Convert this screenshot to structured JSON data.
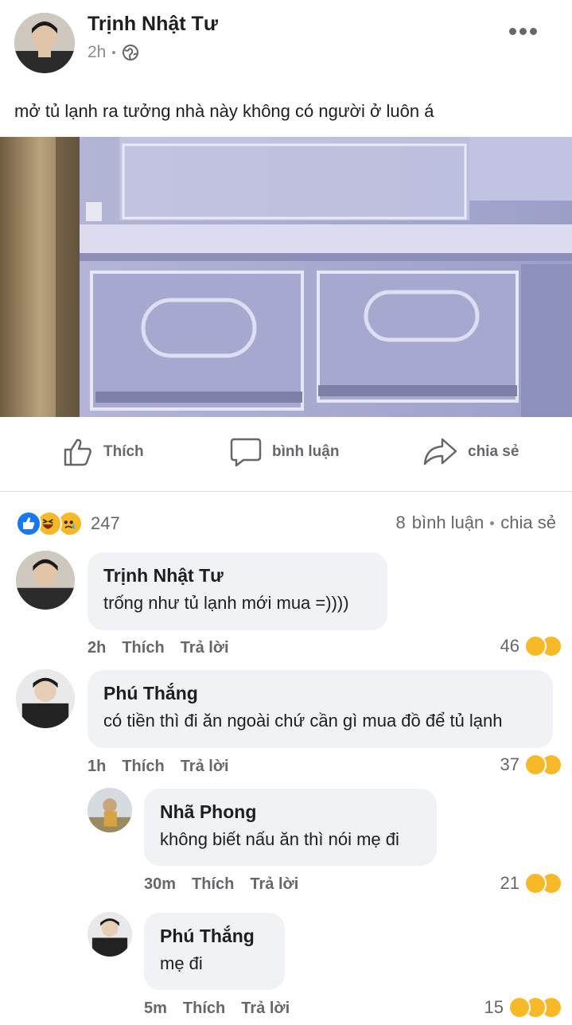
{
  "post": {
    "author": "Trịnh Nhật Tư",
    "time": "2h",
    "text": "mở tủ lạnh ra tưởng nhà này không có người ở luôn á"
  },
  "actions": {
    "like": "Thích",
    "comment": "bình luận",
    "share": "chia sẻ"
  },
  "summary": {
    "reaction_count": "247",
    "comment_count": "8",
    "comments_label": "bình luận",
    "share_label": "chia sẻ",
    "reactions": [
      "like",
      "haha",
      "sad"
    ]
  },
  "comments": [
    {
      "name": "Trịnh Nhật Tư",
      "text": "trống như tủ lạnh mới mua =))))",
      "time": "2h",
      "like": "Thích",
      "reply": "Trả lời",
      "count": "46"
    },
    {
      "name": "Phú Thắng",
      "text": "có tiền thì đi ăn ngoài chứ cần gì mua đồ để tủ lạnh",
      "time": "1h",
      "like": "Thích",
      "reply": "Trả lời",
      "count": "37"
    },
    {
      "name": "Nhã Phong",
      "text": "không biết nấu ăn thì nói mẹ đi",
      "time": "30m",
      "like": "Thích",
      "reply": "Trả lời",
      "count": "21"
    },
    {
      "name": "Phú Thắng",
      "text": "mẹ đi",
      "time": "5m",
      "like": "Thích",
      "reply": "Trả lời",
      "count": "15"
    }
  ],
  "colors": {
    "like_blue": "#1877f2",
    "emoji_yellow": "#f7b928",
    "meta_gray": "#65676b",
    "bubble_bg": "#f0f2f5"
  }
}
